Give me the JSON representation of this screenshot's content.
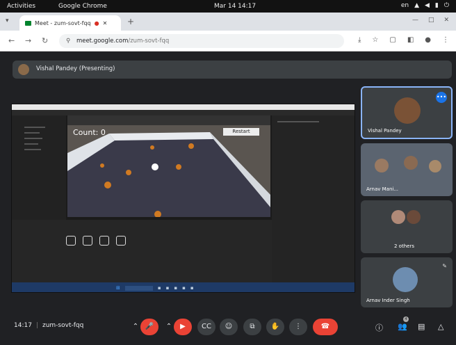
{
  "system_bar": {
    "activities": "Activities",
    "app": "Google Chrome",
    "clock": "Mar 14 14:17",
    "lang": "en"
  },
  "browser": {
    "tab_title": "Meet - zum-sovt-fqq",
    "url_domain": "meet.google.com",
    "url_path": "/zum-sovt-fqq"
  },
  "meet": {
    "presenter_label": "Vishal Pandey (Presenting)",
    "shared_screen": {
      "count_label": "Count: 0",
      "restart_label": "Restart"
    },
    "participants": [
      {
        "name": "Vishal Pandey"
      },
      {
        "name": "Arnav Mani..."
      },
      {
        "name": "2 others"
      },
      {
        "name": "Arnav Inder Singh"
      }
    ],
    "meeting_time": "14:17",
    "meeting_code": "zum-sovt-fqq"
  },
  "colors": {
    "accent": "#1a73e8",
    "end_call": "#ea4335",
    "surface": "#202124",
    "tile": "#3c4043"
  }
}
